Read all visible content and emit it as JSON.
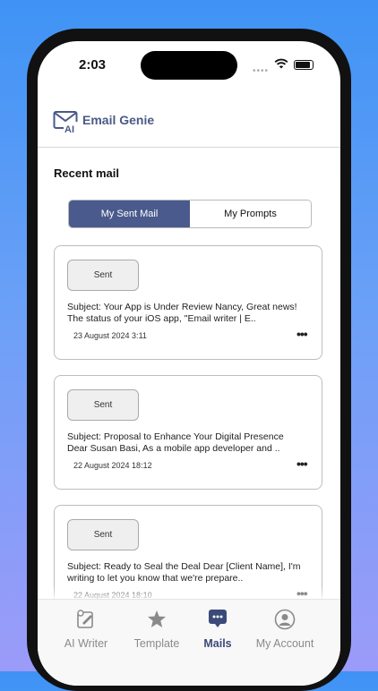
{
  "status_bar": {
    "time": "2:03",
    "signal": "••••"
  },
  "header": {
    "app_name": "Email Genie",
    "logo_icon": "mail-ai-icon"
  },
  "section_title": "Recent mail",
  "segments": [
    {
      "label": "My Sent Mail",
      "active": true
    },
    {
      "label": "My Prompts",
      "active": false
    }
  ],
  "mails": [
    {
      "badge": "Sent",
      "subject_line1": "Subject: Your App is Under Review Nancy, Great news!",
      "subject_line2": "The status of your iOS app, \"Email writer | E..",
      "date": "23 August 2024 3:11",
      "more": "•••"
    },
    {
      "badge": "Sent",
      "subject_line1": "Subject: Proposal to Enhance Your Digital Presence",
      "subject_line2": "Dear Susan Basi, As a mobile app developer and ..",
      "date": "22 August 2024 18:12",
      "more": "•••"
    },
    {
      "badge": "Sent",
      "subject_line1": "Subject: Ready to Seal the Deal Dear [Client Name], I'm",
      "subject_line2": "writing to let you know that we're prepare..",
      "date": "22 August 2024 18:10",
      "more": "•••"
    }
  ],
  "tabs": [
    {
      "label": "AI Writer",
      "icon": "ai-writer-icon",
      "active": false
    },
    {
      "label": "Template",
      "icon": "star-icon",
      "active": false
    },
    {
      "label": "Mails",
      "icon": "chat-bubble-icon",
      "active": true
    },
    {
      "label": "My Account",
      "icon": "user-icon",
      "active": false
    }
  ],
  "colors": {
    "accent": "#4a5a8d",
    "active_tab": "#3b4a78",
    "inactive_tab": "#8a8a8a"
  }
}
